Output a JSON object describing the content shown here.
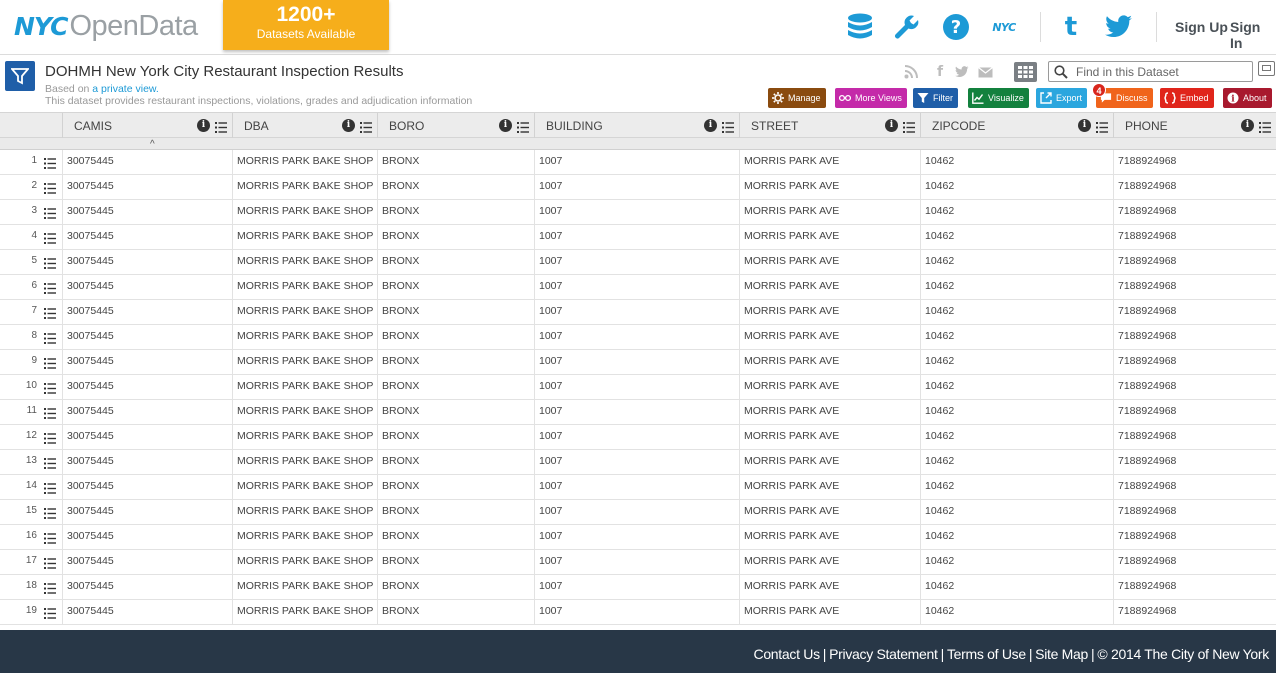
{
  "header": {
    "logo_nyc": "NYC",
    "logo_opendata": "OpenData",
    "datasets_count": "1200+",
    "datasets_label": "Datasets Available",
    "icons": [
      "database-icon",
      "wrench-icon",
      "help-icon",
      "nyc-gov-icon",
      "tumblr-icon",
      "twitter-icon"
    ],
    "nyc_icon_text": "NYC",
    "sign_up": "Sign Up",
    "sign_in": "Sign In",
    "accent_color": "#1d9ad6",
    "badge_color": "#f6ae1b"
  },
  "dataset": {
    "title": "DOHMH New York City Restaurant Inspection Results",
    "based_on_prefix": "Based on",
    "based_on_link": "a private view.",
    "description": "This dataset provides restaurant inspections, violations, grades and adjudication information",
    "search_placeholder": "Find in this Dataset",
    "share_icons": [
      "rss-icon",
      "facebook-icon",
      "twitter-share-icon",
      "email-icon"
    ],
    "actions": [
      {
        "label": "Manage",
        "color": "#8a4b0f",
        "icon": "gear-icon"
      },
      {
        "label": "More Views",
        "color": "#c42aa9",
        "icon": "glasses-icon"
      },
      {
        "label": "Filter",
        "color": "#1f5ea8",
        "icon": "funnel-icon"
      },
      {
        "label": "Visualize",
        "color": "#13813e",
        "icon": "chart-icon"
      },
      {
        "label": "Export",
        "color": "#2ba6de",
        "icon": "export-icon"
      },
      {
        "label": "Discuss",
        "color": "#f0641b",
        "icon": "speech-bubble-icon"
      },
      {
        "label": "Embed",
        "color": "#e0251b",
        "icon": "code-brackets-icon"
      },
      {
        "label": "About",
        "color": "#a8192e",
        "icon": "info-icon"
      }
    ],
    "discuss_count": "4"
  },
  "table": {
    "columns": [
      "CAMIS",
      "DBA",
      "BORO",
      "BUILDING",
      "STREET",
      "ZIPCODE",
      "PHONE"
    ],
    "sort_indicator": "^",
    "rows": [
      {
        "n": "1",
        "camis": "30075445",
        "dba": "MORRIS PARK BAKE SHOP",
        "boro": "BRONX",
        "building": "1007",
        "street": "MORRIS PARK AVE",
        "zipcode": "10462",
        "phone": "7188924968"
      },
      {
        "n": "2",
        "camis": "30075445",
        "dba": "MORRIS PARK BAKE SHOP",
        "boro": "BRONX",
        "building": "1007",
        "street": "MORRIS PARK AVE",
        "zipcode": "10462",
        "phone": "7188924968"
      },
      {
        "n": "3",
        "camis": "30075445",
        "dba": "MORRIS PARK BAKE SHOP",
        "boro": "BRONX",
        "building": "1007",
        "street": "MORRIS PARK AVE",
        "zipcode": "10462",
        "phone": "7188924968"
      },
      {
        "n": "4",
        "camis": "30075445",
        "dba": "MORRIS PARK BAKE SHOP",
        "boro": "BRONX",
        "building": "1007",
        "street": "MORRIS PARK AVE",
        "zipcode": "10462",
        "phone": "7188924968"
      },
      {
        "n": "5",
        "camis": "30075445",
        "dba": "MORRIS PARK BAKE SHOP",
        "boro": "BRONX",
        "building": "1007",
        "street": "MORRIS PARK AVE",
        "zipcode": "10462",
        "phone": "7188924968"
      },
      {
        "n": "6",
        "camis": "30075445",
        "dba": "MORRIS PARK BAKE SHOP",
        "boro": "BRONX",
        "building": "1007",
        "street": "MORRIS PARK AVE",
        "zipcode": "10462",
        "phone": "7188924968"
      },
      {
        "n": "7",
        "camis": "30075445",
        "dba": "MORRIS PARK BAKE SHOP",
        "boro": "BRONX",
        "building": "1007",
        "street": "MORRIS PARK AVE",
        "zipcode": "10462",
        "phone": "7188924968"
      },
      {
        "n": "8",
        "camis": "30075445",
        "dba": "MORRIS PARK BAKE SHOP",
        "boro": "BRONX",
        "building": "1007",
        "street": "MORRIS PARK AVE",
        "zipcode": "10462",
        "phone": "7188924968"
      },
      {
        "n": "9",
        "camis": "30075445",
        "dba": "MORRIS PARK BAKE SHOP",
        "boro": "BRONX",
        "building": "1007",
        "street": "MORRIS PARK AVE",
        "zipcode": "10462",
        "phone": "7188924968"
      },
      {
        "n": "10",
        "camis": "30075445",
        "dba": "MORRIS PARK BAKE SHOP",
        "boro": "BRONX",
        "building": "1007",
        "street": "MORRIS PARK AVE",
        "zipcode": "10462",
        "phone": "7188924968"
      },
      {
        "n": "11",
        "camis": "30075445",
        "dba": "MORRIS PARK BAKE SHOP",
        "boro": "BRONX",
        "building": "1007",
        "street": "MORRIS PARK AVE",
        "zipcode": "10462",
        "phone": "7188924968"
      },
      {
        "n": "12",
        "camis": "30075445",
        "dba": "MORRIS PARK BAKE SHOP",
        "boro": "BRONX",
        "building": "1007",
        "street": "MORRIS PARK AVE",
        "zipcode": "10462",
        "phone": "7188924968"
      },
      {
        "n": "13",
        "camis": "30075445",
        "dba": "MORRIS PARK BAKE SHOP",
        "boro": "BRONX",
        "building": "1007",
        "street": "MORRIS PARK AVE",
        "zipcode": "10462",
        "phone": "7188924968"
      },
      {
        "n": "14",
        "camis": "30075445",
        "dba": "MORRIS PARK BAKE SHOP",
        "boro": "BRONX",
        "building": "1007",
        "street": "MORRIS PARK AVE",
        "zipcode": "10462",
        "phone": "7188924968"
      },
      {
        "n": "15",
        "camis": "30075445",
        "dba": "MORRIS PARK BAKE SHOP",
        "boro": "BRONX",
        "building": "1007",
        "street": "MORRIS PARK AVE",
        "zipcode": "10462",
        "phone": "7188924968"
      },
      {
        "n": "16",
        "camis": "30075445",
        "dba": "MORRIS PARK BAKE SHOP",
        "boro": "BRONX",
        "building": "1007",
        "street": "MORRIS PARK AVE",
        "zipcode": "10462",
        "phone": "7188924968"
      },
      {
        "n": "17",
        "camis": "30075445",
        "dba": "MORRIS PARK BAKE SHOP",
        "boro": "BRONX",
        "building": "1007",
        "street": "MORRIS PARK AVE",
        "zipcode": "10462",
        "phone": "7188924968"
      },
      {
        "n": "18",
        "camis": "30075445",
        "dba": "MORRIS PARK BAKE SHOP",
        "boro": "BRONX",
        "building": "1007",
        "street": "MORRIS PARK AVE",
        "zipcode": "10462",
        "phone": "7188924968"
      },
      {
        "n": "19",
        "camis": "30075445",
        "dba": "MORRIS PARK BAKE SHOP",
        "boro": "BRONX",
        "building": "1007",
        "street": "MORRIS PARK AVE",
        "zipcode": "10462",
        "phone": "7188924968"
      }
    ]
  },
  "footer": {
    "links": [
      "Contact Us",
      "Privacy Statement",
      "Terms of Use",
      "Site Map"
    ],
    "copyright": "© 2014 The City of New York",
    "background": "#283747"
  }
}
